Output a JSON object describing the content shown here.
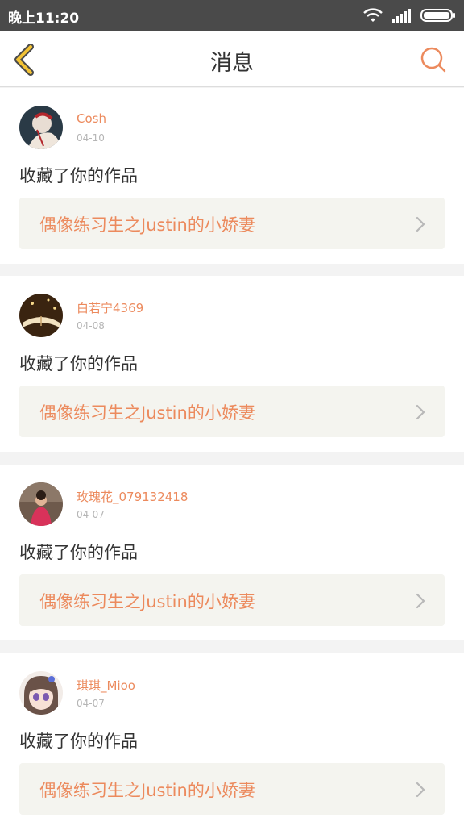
{
  "status_bar": {
    "time": "晚上11:20",
    "icons": [
      "wifi-icon",
      "signal-icon",
      "battery-icon"
    ]
  },
  "header": {
    "title": "消息",
    "back_icon": "chevron-left-icon",
    "search_icon": "search-icon"
  },
  "colors": {
    "accent": "#ec8a5d",
    "back_arrow": "#f2c235",
    "status_bar": "#4a4a4a",
    "work_box_bg": "#f4f4ef"
  },
  "messages": [
    {
      "user": "Cosh",
      "date": "04-10",
      "action": "收藏了你的作品",
      "work_title": "偶像练习生之Justin的小娇妻"
    },
    {
      "user": "白若宁4369",
      "date": "04-08",
      "action": "收藏了你的作品",
      "work_title": "偶像练习生之Justin的小娇妻"
    },
    {
      "user": "玫瑰花_079132418",
      "date": "04-07",
      "action": "收藏了你的作品",
      "work_title": "偶像练习生之Justin的小娇妻"
    },
    {
      "user": "琪琪_Mioo",
      "date": "04-07",
      "action": "收藏了你的作品",
      "work_title": "偶像练习生之Justin的小娇妻"
    }
  ]
}
